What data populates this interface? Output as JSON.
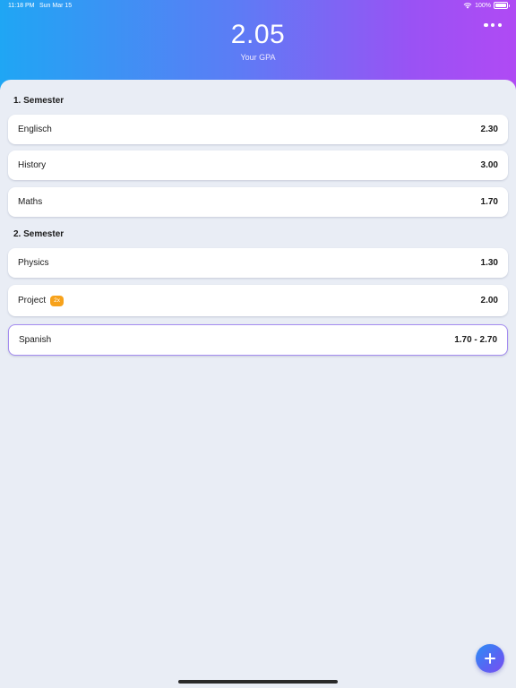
{
  "status": {
    "time": "11:18 PM",
    "date": "Sun Mar 15",
    "battery": "100%"
  },
  "header": {
    "gpa_value": "2.05",
    "gpa_label": "Your GPA"
  },
  "semesters": [
    {
      "title": "1. Semester",
      "courses": [
        {
          "name": "Englisch",
          "grade": "2.30"
        },
        {
          "name": "History",
          "grade": "3.00"
        },
        {
          "name": "Maths",
          "grade": "1.70"
        }
      ]
    },
    {
      "title": "2. Semester",
      "courses": [
        {
          "name": "Physics",
          "grade": "1.30"
        },
        {
          "name": "Project",
          "badge": "2x",
          "grade": "2.00"
        },
        {
          "name": "Spanish",
          "grade": "1.70 - 2.70",
          "selected": true
        }
      ]
    }
  ],
  "colors": {
    "accent": "#5b7df5",
    "badge": "#f7a21b",
    "selection_border": "#a48cf0"
  },
  "icons": {
    "menu": "more-horizontal-icon",
    "add": "plus-icon",
    "wifi": "wifi-icon",
    "battery": "battery-icon"
  }
}
